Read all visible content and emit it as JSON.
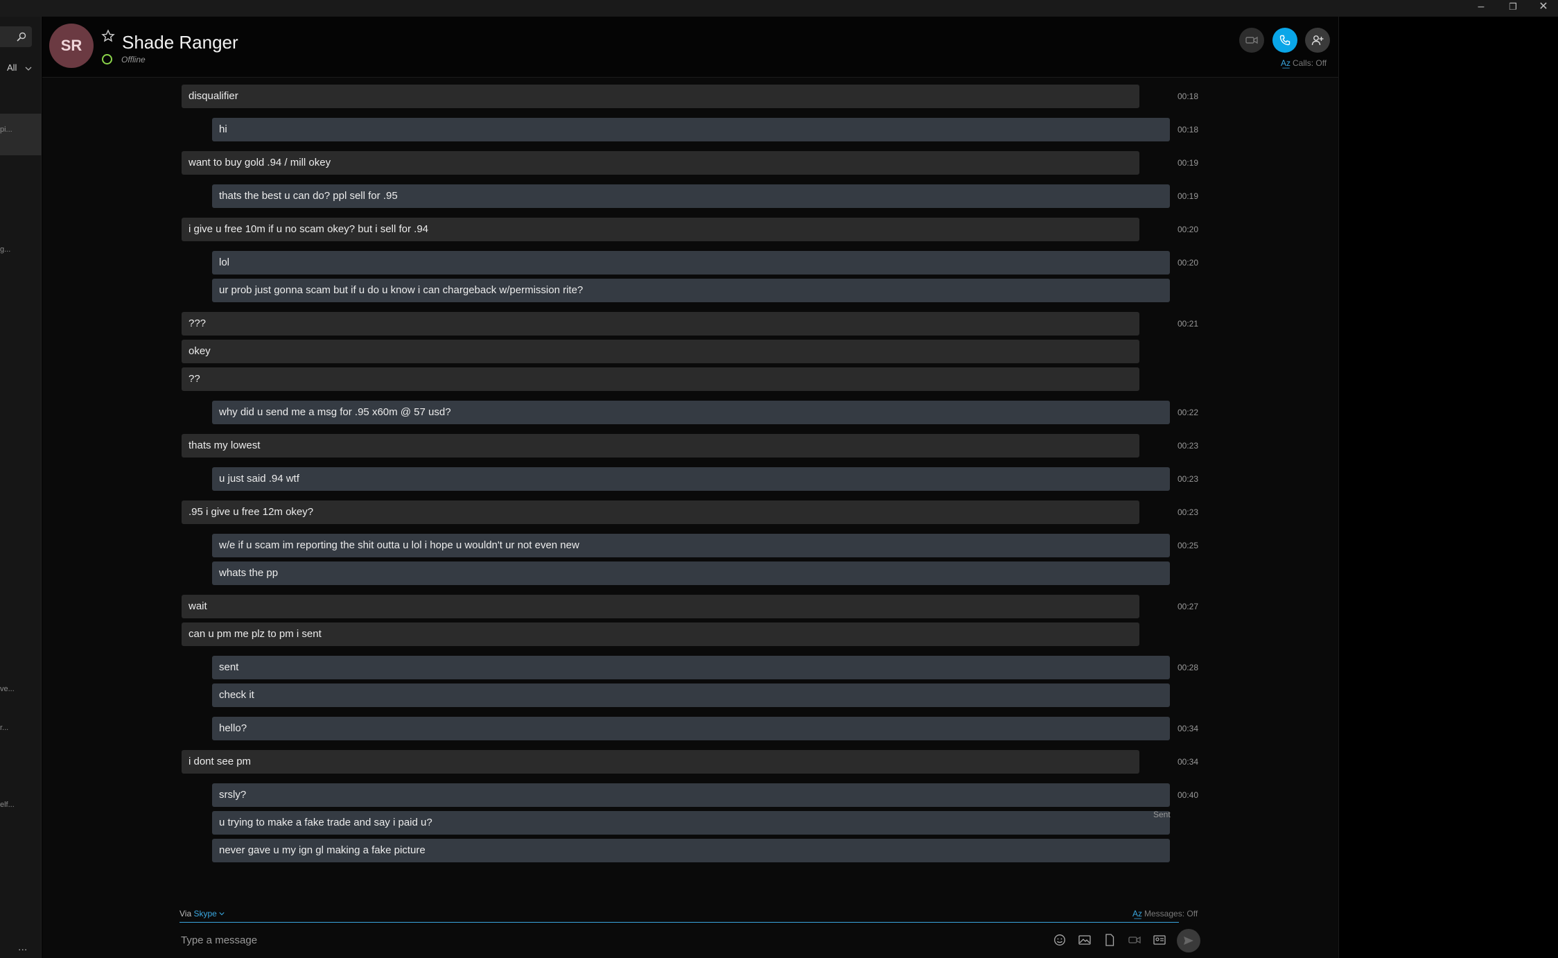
{
  "window": {
    "minimize_glyph": "–",
    "restore_glyph": "❐",
    "close_glyph": "✕"
  },
  "sidebar": {
    "filter_label": "All",
    "fragments": [
      "pi...",
      "g...",
      "ve...",
      "r...",
      "elf..."
    ],
    "more_glyph": "..."
  },
  "header": {
    "avatar_initials": "SR",
    "contact_name": "Shade Ranger",
    "status": "Offline",
    "calls_translation": "Calls: Off",
    "translate_glyph": "A͟z"
  },
  "messages": [
    {
      "dir": "in",
      "text": "disqualifier",
      "time": "00:18"
    },
    {
      "dir": "out",
      "text": "hi",
      "time": "00:18"
    },
    {
      "dir": "in",
      "text": "want to buy gold .94 / mill okey",
      "time": "00:19"
    },
    {
      "dir": "out",
      "text": "thats the best u can do? ppl sell for .95",
      "time": "00:19"
    },
    {
      "dir": "in",
      "text": "i give u free 10m if u no scam okey? but i sell for .94",
      "time": "00:20"
    },
    {
      "dir": "out",
      "text": "lol",
      "time": "00:20"
    },
    {
      "dir": "out",
      "text": "ur prob just gonna scam but if u do u know i can chargeback w/permission rite?",
      "time": ""
    },
    {
      "dir": "in",
      "text": "???",
      "time": "00:21"
    },
    {
      "dir": "in",
      "text": "okey",
      "time": ""
    },
    {
      "dir": "in",
      "text": "??",
      "time": ""
    },
    {
      "dir": "out",
      "text": "why did u send me a msg for .95 x60m @ 57 usd?",
      "time": "00:22"
    },
    {
      "dir": "in",
      "text": "thats my lowest",
      "time": "00:23"
    },
    {
      "dir": "out",
      "text": "u just said .94 wtf",
      "time": "00:23"
    },
    {
      "dir": "in",
      "text": ".95 i give u free 12m okey?",
      "time": "00:23"
    },
    {
      "dir": "out",
      "text": "w/e if u scam im reporting the shit outta u lol i hope u wouldn't ur not even new",
      "time": "00:25"
    },
    {
      "dir": "out",
      "text": "whats the pp",
      "time": ""
    },
    {
      "dir": "in",
      "text": "wait",
      "time": "00:27"
    },
    {
      "dir": "in",
      "text": "can u pm me plz to pm i sent",
      "time": ""
    },
    {
      "dir": "out",
      "text": "sent",
      "time": "00:28"
    },
    {
      "dir": "out",
      "text": "check it",
      "time": ""
    },
    {
      "dir": "out",
      "text": "hello?",
      "time": "00:34"
    },
    {
      "dir": "in",
      "text": "i dont see pm",
      "time": "00:34"
    },
    {
      "dir": "out",
      "text": "srsly?",
      "time": "00:40"
    },
    {
      "dir": "out",
      "text": "u trying to make a fake trade and say i paid u?",
      "time": ""
    },
    {
      "dir": "out",
      "text": "never gave u my ign gl making a fake picture",
      "time": ""
    }
  ],
  "receipt": "Sent",
  "composer": {
    "via_prefix": "Via",
    "via_service": "Skype",
    "messages_translation": "Messages: Off",
    "placeholder": "Type a message"
  },
  "colors": {
    "accent": "#0aa6e8",
    "incoming_bubble": "#2b2b2b",
    "outgoing_bubble": "#353b43",
    "status_offline_ring": "#8bd44a",
    "avatar_bg": "#6b3a42"
  }
}
